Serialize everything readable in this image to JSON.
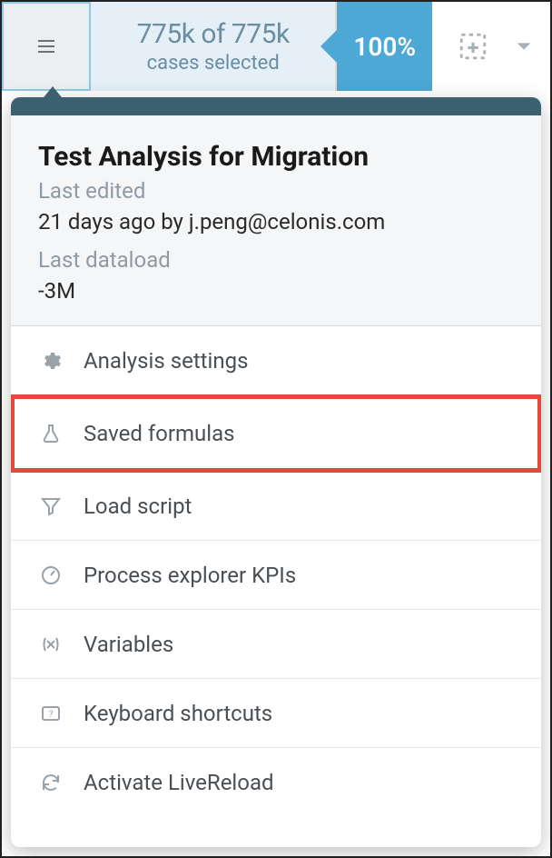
{
  "toolbar": {
    "cases_count": "775k of 775k",
    "cases_label": "cases selected",
    "percent": "100%"
  },
  "panel": {
    "title": "Test Analysis for Migration",
    "last_edited_label": "Last edited",
    "last_edited_value": "21 days ago by j.peng@celonis.com",
    "last_dataload_label": "Last dataload",
    "last_dataload_value": "-3M"
  },
  "menu": {
    "settings": "Analysis settings",
    "formulas": "Saved formulas",
    "load_script": "Load script",
    "kpis": "Process explorer KPIs",
    "variables": "Variables",
    "shortcuts": "Keyboard shortcuts",
    "livereload": "Activate LiveReload"
  }
}
